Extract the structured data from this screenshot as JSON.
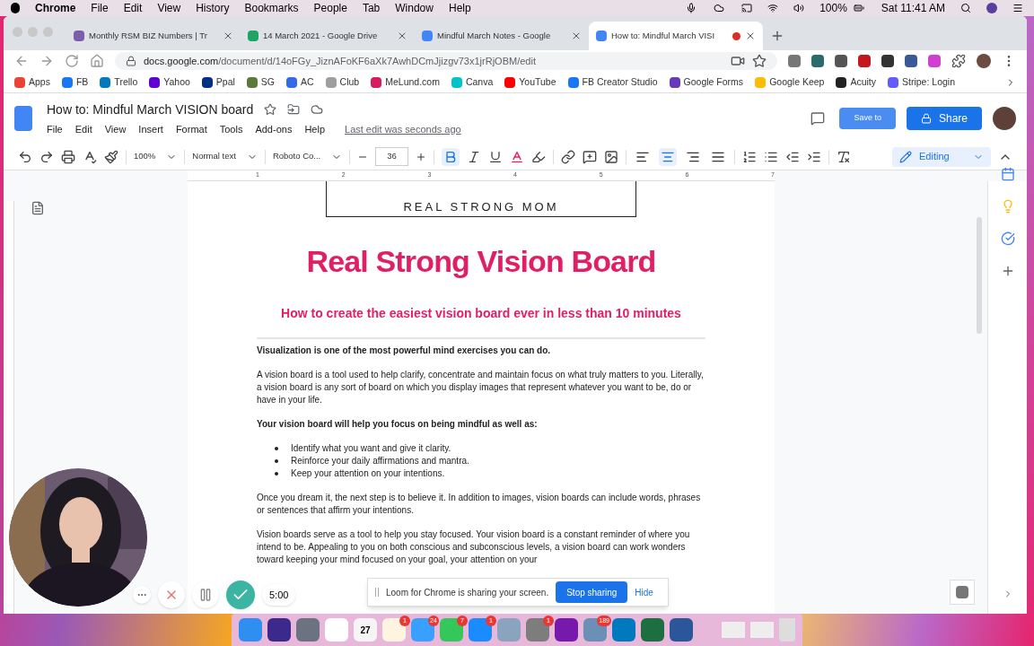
{
  "menubar": {
    "app": "Chrome",
    "menus": [
      "File",
      "Edit",
      "View",
      "History",
      "Bookmarks",
      "People",
      "Tab",
      "Window",
      "Help"
    ],
    "battery": "100%",
    "clock": "Sat 11:41 AM"
  },
  "tabs": [
    {
      "title": "Monthly RSM BIZ Numbers | Tr",
      "selected": false,
      "color": "#7b5ea7"
    },
    {
      "title": "14 March 2021 - Google Drive",
      "selected": false,
      "color": "#1fa463"
    },
    {
      "title": "Mindful March Notes - Google",
      "selected": false,
      "color": "#4285f4"
    },
    {
      "title": "How to: Mindful March VISI",
      "selected": true,
      "color": "#4285f4"
    }
  ],
  "address": {
    "host": "docs.google.com",
    "path": "/document/d/14oFGy_JiznAFoKF6aXk7AwhDCmJjizgv73x1jrRjOBM/edit"
  },
  "bookmarks": [
    {
      "label": "Apps",
      "color": "#ea4335"
    },
    {
      "label": "FB",
      "color": "#1877f2"
    },
    {
      "label": "Trello",
      "color": "#0079bf"
    },
    {
      "label": "Yahoo",
      "color": "#6001d2"
    },
    {
      "label": "Ppal",
      "color": "#003087"
    },
    {
      "label": "SG",
      "color": "#5b7a3a"
    },
    {
      "label": "AC",
      "color": "#356ae6"
    },
    {
      "label": "Club",
      "color": "#9e9e9e"
    },
    {
      "label": "MeLund.com",
      "color": "#d81b60"
    },
    {
      "label": "Canva",
      "color": "#00c4cc"
    },
    {
      "label": "YouTube",
      "color": "#ff0000"
    },
    {
      "label": "FB Creator Studio",
      "color": "#1877f2"
    },
    {
      "label": "Google Forms",
      "color": "#673ab7"
    },
    {
      "label": "Google Keep",
      "color": "#fbbc04"
    },
    {
      "label": "Acuity",
      "color": "#222222"
    },
    {
      "label": "Stripe: Login",
      "color": "#635bff"
    }
  ],
  "docs": {
    "title": "How to: Mindful March VISION board",
    "menus": [
      "File",
      "Edit",
      "View",
      "Insert",
      "Format",
      "Tools",
      "Add-ons",
      "Help"
    ],
    "last_edit": "Last edit was seconds ago",
    "save_to": "Save to",
    "share": "Share"
  },
  "toolbar": {
    "zoom": "100%",
    "style": "Normal text",
    "font": "Roboto Co...",
    "size": "36",
    "bold": true,
    "align": [
      {
        "kind": "left",
        "selected": false
      },
      {
        "kind": "center",
        "selected": true
      },
      {
        "kind": "right",
        "selected": false
      },
      {
        "kind": "justify",
        "selected": false
      }
    ],
    "mode": "Editing"
  },
  "ruler": [
    "1",
    "2",
    "3",
    "4",
    "5",
    "6",
    "7"
  ],
  "document": {
    "logo_text": "REAL STRONG MOM",
    "title": "Real Strong Vision Board",
    "subtitle": "How to create the easiest vision board ever in less than 10 minutes",
    "blocks": [
      {
        "kind": "heading",
        "text": "Visualization is one of the most powerful mind exercises you can do."
      },
      {
        "kind": "paragraph",
        "text": "A vision board is a tool used to help clarify, concentrate and maintain focus on what truly matters to you. Literally, a vision board is any sort of board on which you display images that represent whatever you want to be, do or have in your life."
      },
      {
        "kind": "heading",
        "text": "Your vision board will help you focus on being mindful as well as:"
      },
      {
        "kind": "bullets",
        "items": [
          "Identify what you want and give it clarity.",
          "Reinforce your daily affirmations and mantra.",
          "Keep your attention on your intentions."
        ]
      },
      {
        "kind": "paragraph",
        "text": "Once you dream it, the next step is to believe it. In addition to images, vision boards can include words, phrases or sentences that affirm your intentions."
      },
      {
        "kind": "paragraph",
        "text": "Vision boards serve as a tool to help you stay focused. Your vision board is a constant reminder of where you intend to be. Appealing to you on both conscious and subconscious levels, a vision board can work wonders toward keeping your mind focused on your goal, your attention on your"
      }
    ]
  },
  "loom": {
    "timer": "5:00",
    "message": "Loom for Chrome is sharing your screen.",
    "stop": "Stop sharing",
    "hide": "Hide"
  },
  "dock": [
    {
      "color": "#2f8ff0"
    },
    {
      "color": "#3b2a8c"
    },
    {
      "color": "#6b7280"
    },
    {
      "color": "#ffffff"
    },
    {
      "color": "#f5f5f5",
      "text": "27"
    },
    {
      "color": "#fff4e0",
      "badge": "1"
    },
    {
      "color": "#3aa0ff",
      "badge": "24"
    },
    {
      "color": "#34c759",
      "badge": "7"
    },
    {
      "color": "#1a8cff",
      "badge": "1"
    },
    {
      "color": "#8aa4c0"
    },
    {
      "color": "#7d7d7d",
      "badge": "1"
    },
    {
      "color": "#7719aa"
    },
    {
      "color": "#6c8fb5",
      "badge": "189"
    },
    {
      "color": "#0079bf"
    },
    {
      "color": "#1d6f42"
    },
    {
      "color": "#2b579a"
    }
  ]
}
